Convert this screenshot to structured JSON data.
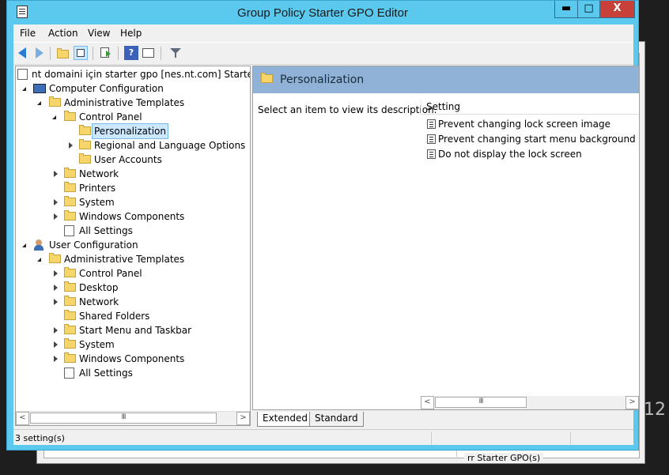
{
  "window": {
    "title": "Group Policy Starter GPO Editor",
    "minimize": "▬",
    "maximize": "□",
    "close": "X"
  },
  "menu": [
    "File",
    "Action",
    "View",
    "Help"
  ],
  "tree": {
    "root": "nt domaini için starter gpo [nes.nt.com] Starter GP",
    "computer": {
      "label": "Computer Configuration",
      "admin": "Administrative Templates",
      "control_panel": "Control Panel",
      "personalization": "Personalization",
      "regional": "Regional and Language Options",
      "user_accounts": "User Accounts",
      "network": "Network",
      "printers": "Printers",
      "system": "System",
      "windows_components": "Windows Components",
      "all_settings": "All Settings"
    },
    "user": {
      "label": "User Configuration",
      "admin": "Administrative Templates",
      "control_panel": "Control Panel",
      "desktop": "Desktop",
      "network": "Network",
      "shared_folders": "Shared Folders",
      "start_menu": "Start Menu and Taskbar",
      "system": "System",
      "windows_components": "Windows Components",
      "all_settings": "All Settings"
    }
  },
  "scroll_thumb": "III",
  "scroll_left": "<",
  "scroll_right": ">",
  "details": {
    "header": "Personalization",
    "description": "Select an item to view its description.",
    "column": "Setting",
    "settings": [
      "Prevent changing lock screen image",
      "Prevent changing start menu background",
      "Do not display the lock screen"
    ]
  },
  "tabs": {
    "extended": "Extended",
    "standard": "Standard"
  },
  "status": "3 setting(s)",
  "background": {
    "text": "rr Starter GPO(s)",
    "number": "12"
  }
}
